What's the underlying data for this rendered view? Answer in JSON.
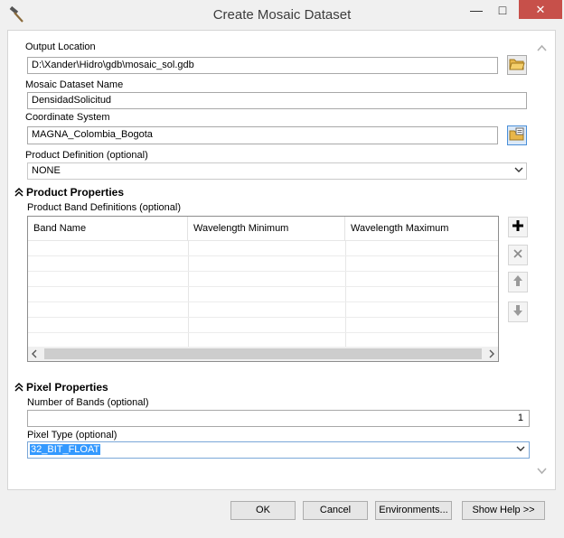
{
  "window": {
    "title": "Create Mosaic Dataset",
    "minimize": "—",
    "maximize": "□",
    "close": "✕"
  },
  "form": {
    "output_location": {
      "label": "Output Location",
      "value": "D:\\Xander\\Hidro\\gdb\\mosaic_sol.gdb"
    },
    "mosaic_name": {
      "label": "Mosaic Dataset Name",
      "value": "DensidadSolicitud"
    },
    "coordinate_system": {
      "label": "Coordinate System",
      "value": "MAGNA_Colombia_Bogota"
    },
    "product_definition": {
      "label": "Product Definition (optional)",
      "value": "NONE"
    }
  },
  "product_properties": {
    "heading": "Product Properties",
    "band_defs_label": "Product Band Definitions (optional)",
    "columns": [
      "Band Name",
      "Wavelength Minimum",
      "Wavelength Maximum"
    ]
  },
  "pixel_properties": {
    "heading": "Pixel Properties",
    "bands_label": "Number of Bands (optional)",
    "bands_value": "1",
    "pixel_type_label": "Pixel Type (optional)",
    "pixel_type_value": "32_BIT_FLOAT"
  },
  "buttons": {
    "ok": "OK",
    "cancel": "Cancel",
    "environments": "Environments...",
    "help": "Show Help >>"
  }
}
